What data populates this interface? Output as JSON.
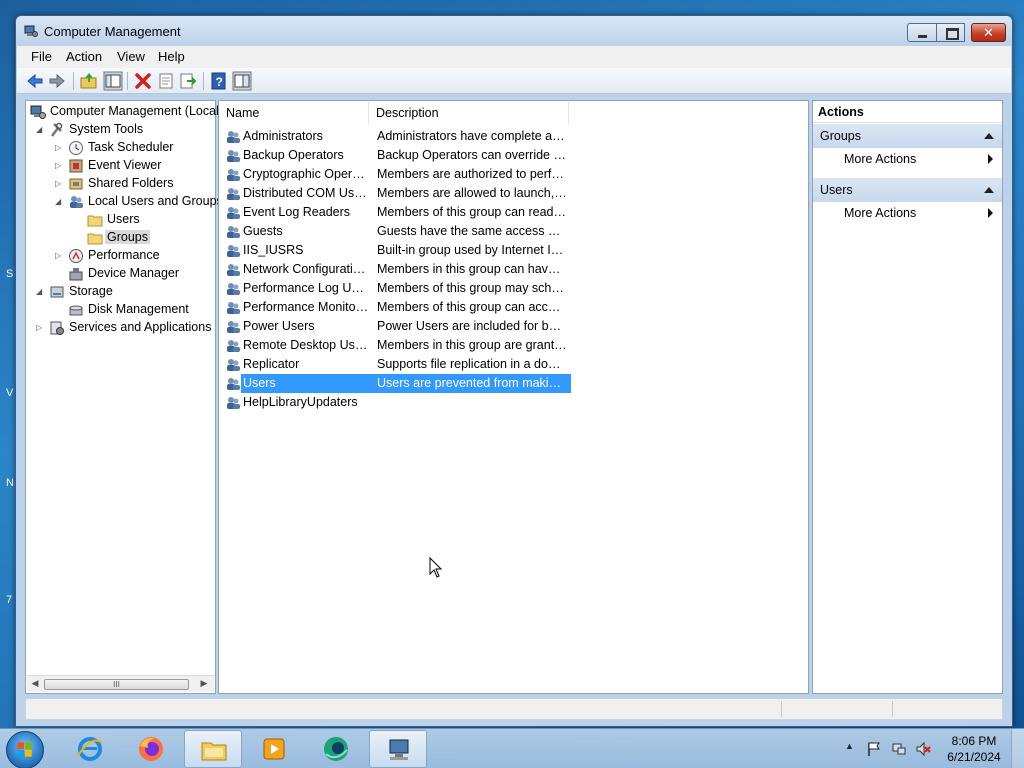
{
  "window": {
    "title": "Computer Management",
    "close_glyph": "✕"
  },
  "menu": [
    "File",
    "Action",
    "View",
    "Help"
  ],
  "toolbar": {
    "buttons": [
      "back-icon",
      "forward-icon",
      "up-folder-icon",
      "show-hide-tree-icon",
      "delete-icon",
      "properties-icon",
      "export-list-icon",
      "help-icon",
      "show-hide-action-pane-icon"
    ]
  },
  "tree": {
    "items": [
      {
        "label": "Computer Management (Local",
        "icon": "computer-management-icon",
        "expander": ""
      },
      {
        "label": "System Tools",
        "icon": "system-tools-icon",
        "expander": "◢"
      },
      {
        "label": "Task Scheduler",
        "icon": "clock-icon",
        "expander": "▷"
      },
      {
        "label": "Event Viewer",
        "icon": "event-viewer-icon",
        "expander": "▷"
      },
      {
        "label": "Shared Folders",
        "icon": "shared-folders-icon",
        "expander": "▷"
      },
      {
        "label": "Local Users and Groups",
        "icon": "users-icon",
        "expander": "◢"
      },
      {
        "label": "Users",
        "icon": "folder-icon",
        "expander": ""
      },
      {
        "label": "Groups",
        "icon": "folder-icon",
        "expander": ""
      },
      {
        "label": "Performance",
        "icon": "performance-icon",
        "expander": "▷"
      },
      {
        "label": "Device Manager",
        "icon": "device-manager-icon",
        "expander": ""
      },
      {
        "label": "Storage",
        "icon": "storage-icon",
        "expander": "◢"
      },
      {
        "label": "Disk Management",
        "icon": "disk-icon",
        "expander": ""
      },
      {
        "label": "Services and Applications",
        "icon": "services-icon",
        "expander": "▷"
      }
    ],
    "scroll_thumb": "III"
  },
  "list": {
    "columns": [
      "Name",
      "Description"
    ],
    "rows": [
      {
        "name": "Administrators",
        "desc": "Administrators have complete an..."
      },
      {
        "name": "Backup Operators",
        "desc": "Backup Operators can override se..."
      },
      {
        "name": "Cryptographic Operat...",
        "desc": "Members are authorized to perfor..."
      },
      {
        "name": "Distributed COM Users",
        "desc": "Members are allowed to launch, a..."
      },
      {
        "name": "Event Log Readers",
        "desc": "Members of this group can read e..."
      },
      {
        "name": "Guests",
        "desc": "Guests have the same access as m..."
      },
      {
        "name": "IIS_IUSRS",
        "desc": "Built-in group used by Internet Inf..."
      },
      {
        "name": "Network Configuratio...",
        "desc": "Members in this group can have s..."
      },
      {
        "name": "Performance Log Users",
        "desc": "Members of this group may sche..."
      },
      {
        "name": "Performance Monitor ...",
        "desc": "Members of this group can acces..."
      },
      {
        "name": "Power Users",
        "desc": "Power Users are included for back..."
      },
      {
        "name": "Remote Desktop Users",
        "desc": "Members in this group are grante..."
      },
      {
        "name": "Replicator",
        "desc": "Supports file replication in a dom..."
      },
      {
        "name": "Users",
        "desc": "Users are prevented from making ..."
      },
      {
        "name": "HelpLibraryUpdaters",
        "desc": ""
      }
    ]
  },
  "actions": {
    "title": "Actions",
    "sections": [
      {
        "label": "Groups",
        "item": "More Actions"
      },
      {
        "label": "Users",
        "item": "More Actions"
      }
    ]
  },
  "taskbar": {
    "apps": [
      "internet-explorer-icon",
      "firefox-icon",
      "file-explorer-icon",
      "media-player-icon",
      "browser-icon",
      "computer-management-icon"
    ],
    "clock_time": "8:06 PM",
    "clock_date": "6/21/2024"
  },
  "desktop_edge": [
    "S",
    "V",
    "N",
    "7"
  ],
  "colors": {
    "selection": "#3399ff",
    "action_section": "#c7d8ec",
    "close_button": "#c5422b"
  }
}
